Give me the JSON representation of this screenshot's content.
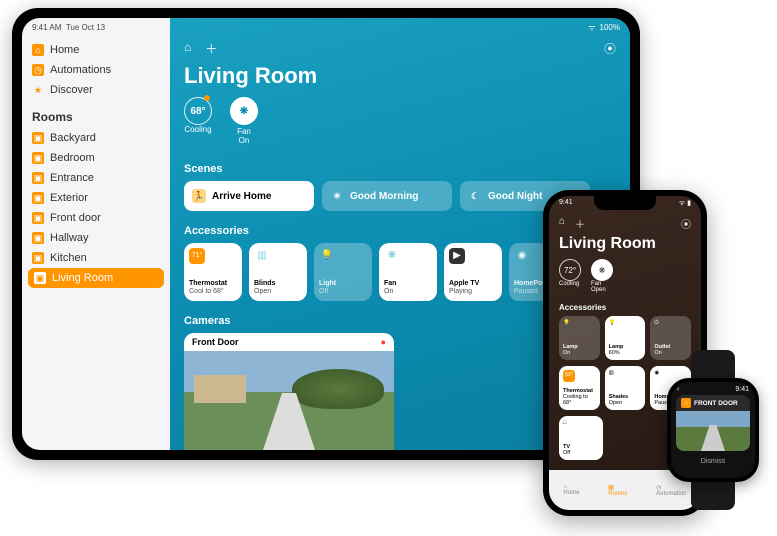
{
  "ipad": {
    "status": {
      "time": "9:41 AM",
      "date": "Tue Oct 13",
      "battery": "100%"
    },
    "sidebar": {
      "primary": [
        {
          "icon": "house",
          "label": "Home"
        },
        {
          "icon": "auto",
          "label": "Automations"
        },
        {
          "icon": "star",
          "label": "Discover"
        }
      ],
      "rooms_header": "Rooms",
      "rooms": [
        {
          "label": "Backyard",
          "selected": false
        },
        {
          "label": "Bedroom",
          "selected": false
        },
        {
          "label": "Entrance",
          "selected": false
        },
        {
          "label": "Exterior",
          "selected": false
        },
        {
          "label": "Front door",
          "selected": false
        },
        {
          "label": "Hallway",
          "selected": false
        },
        {
          "label": "Kitchen",
          "selected": false
        },
        {
          "label": "Living Room",
          "selected": true
        }
      ]
    },
    "main": {
      "title": "Living Room",
      "summary": [
        {
          "value": "68°",
          "label": "Cooling",
          "filled": false,
          "dot": true
        },
        {
          "value": "❋",
          "label": "Fan\nOn",
          "filled": true,
          "dot": false
        }
      ],
      "scenes_header": "Scenes",
      "scenes": [
        {
          "icon": "🏃",
          "label": "Arrive Home",
          "active": true
        },
        {
          "icon": "☀",
          "label": "Good Morning",
          "active": false
        },
        {
          "icon": "☾",
          "label": "Good Night",
          "active": false
        }
      ],
      "accessories_header": "Accessories",
      "accessories": [
        {
          "icon": "71°",
          "iconBg": "#ff9500",
          "name": "Thermostat",
          "state": "Cool to 68°",
          "on": true
        },
        {
          "icon": "▥",
          "iconBg": "#7fd3e6",
          "name": "Blinds",
          "state": "Open",
          "on": true
        },
        {
          "icon": "💡",
          "iconBg": "#7fd3e6",
          "name": "Light",
          "state": "Off",
          "on": false
        },
        {
          "icon": "❋",
          "iconBg": "#6fc5da",
          "name": "Fan",
          "state": "On",
          "on": true
        },
        {
          "icon": "▶",
          "iconBg": "#333",
          "name": "Apple TV",
          "state": "Playing",
          "on": true
        },
        {
          "icon": "◉",
          "iconBg": "rgba(255,255,255,.35)",
          "name": "HomePod",
          "state": "Paused",
          "on": false
        }
      ],
      "cameras_header": "Cameras",
      "camera": {
        "name": "Front Door"
      }
    }
  },
  "iphone": {
    "status": {
      "time": "9:41"
    },
    "title": "Living Room",
    "summary": [
      {
        "value": "72°",
        "label": "Cooling",
        "filled": false
      },
      {
        "value": "❋",
        "label": "Fan\nOpen",
        "filled": true
      }
    ],
    "accessories_header": "Accessories",
    "row1": [
      {
        "icon": "💡",
        "name": "Lamp",
        "state": "On",
        "on": false
      },
      {
        "icon": "💡",
        "name": "Lamp",
        "state": "60%",
        "on": true
      },
      {
        "icon": "⏻",
        "name": "Outlet",
        "state": "On",
        "on": false
      }
    ],
    "row2": [
      {
        "icon": "69°",
        "name": "Thermostat",
        "state": "Cooling to 68°",
        "on": true
      },
      {
        "icon": "▥",
        "name": "Shades",
        "state": "Open",
        "on": true
      },
      {
        "icon": "◉",
        "name": "HomePod",
        "state": "Paused",
        "on": true
      }
    ],
    "row3": [
      {
        "icon": "□",
        "name": "TV",
        "state": "Off",
        "on": true
      }
    ],
    "tabs": [
      {
        "label": "Home",
        "active": false
      },
      {
        "label": "Rooms",
        "active": true
      },
      {
        "label": "Automation",
        "active": false
      }
    ]
  },
  "watch": {
    "time": "9:41",
    "card_title": "FRONT DOOR",
    "dismiss": "Dismiss"
  }
}
